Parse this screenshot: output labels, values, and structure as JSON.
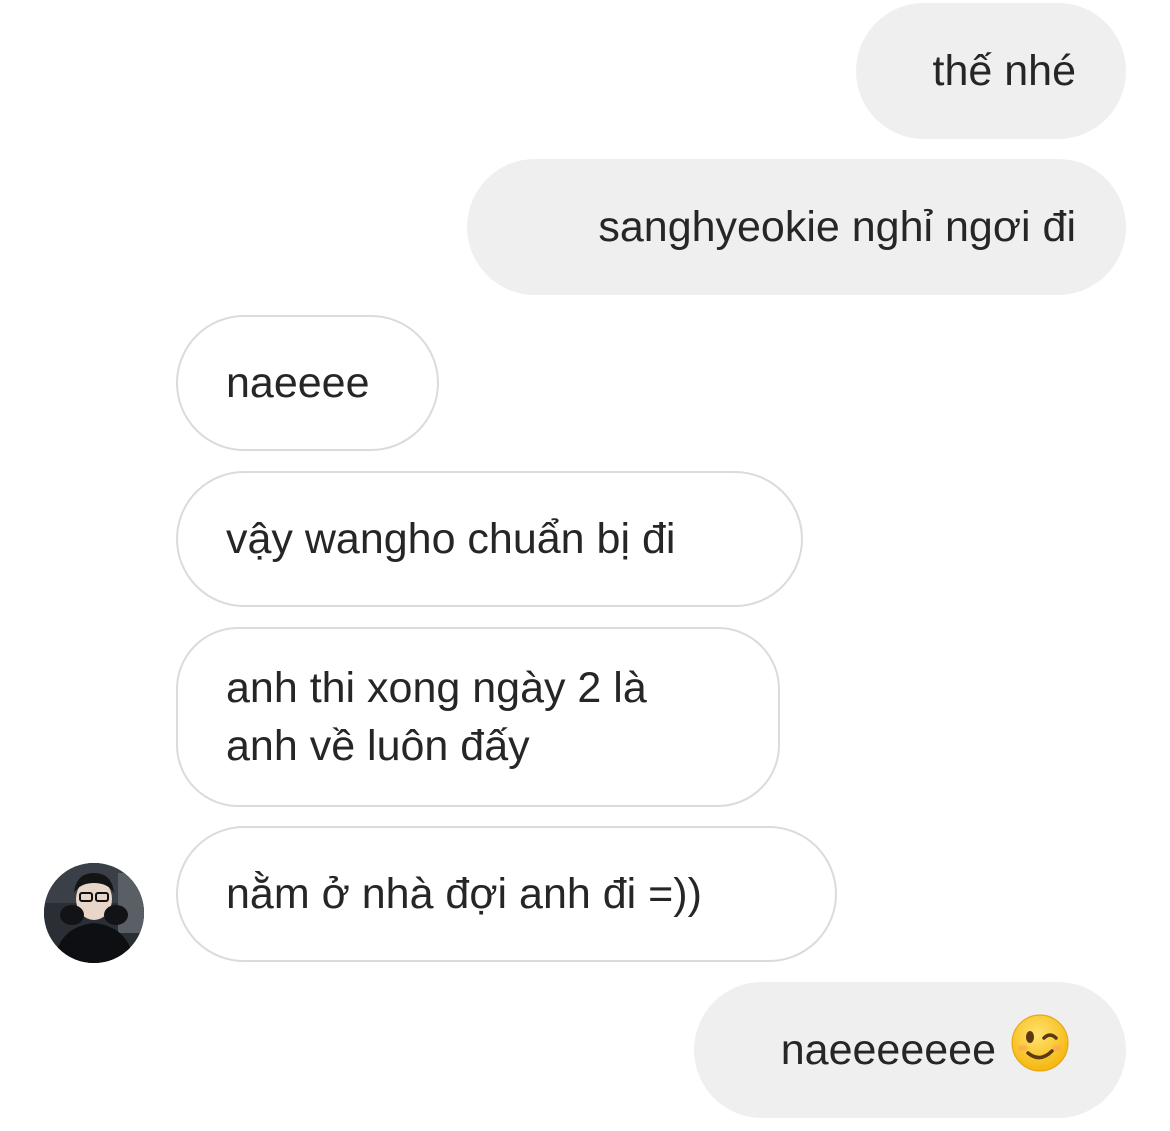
{
  "conversation": {
    "messages": [
      {
        "id": "m1",
        "direction": "sent",
        "text": "thế nhé"
      },
      {
        "id": "m2",
        "direction": "sent",
        "text": "sanghyeokie nghỉ ngơi đi"
      },
      {
        "id": "m3",
        "direction": "received",
        "text": "naeeee"
      },
      {
        "id": "m4",
        "direction": "received",
        "text": "vậy wangho chuẩn bị đi"
      },
      {
        "id": "m5",
        "direction": "received",
        "text": "anh thi xong ngày 2 là anh về luôn đấy"
      },
      {
        "id": "m6",
        "direction": "received",
        "text": "nằm ở nhà đợi anh đi =))"
      },
      {
        "id": "m7",
        "direction": "sent",
        "text": "naeeeeeee",
        "emoji": "winking-face-emoji"
      }
    ]
  },
  "colors": {
    "sent_bubble": "#efefef",
    "received_bubble_border": "#dbdbdb",
    "text": "#262626",
    "background": "#ffffff"
  }
}
